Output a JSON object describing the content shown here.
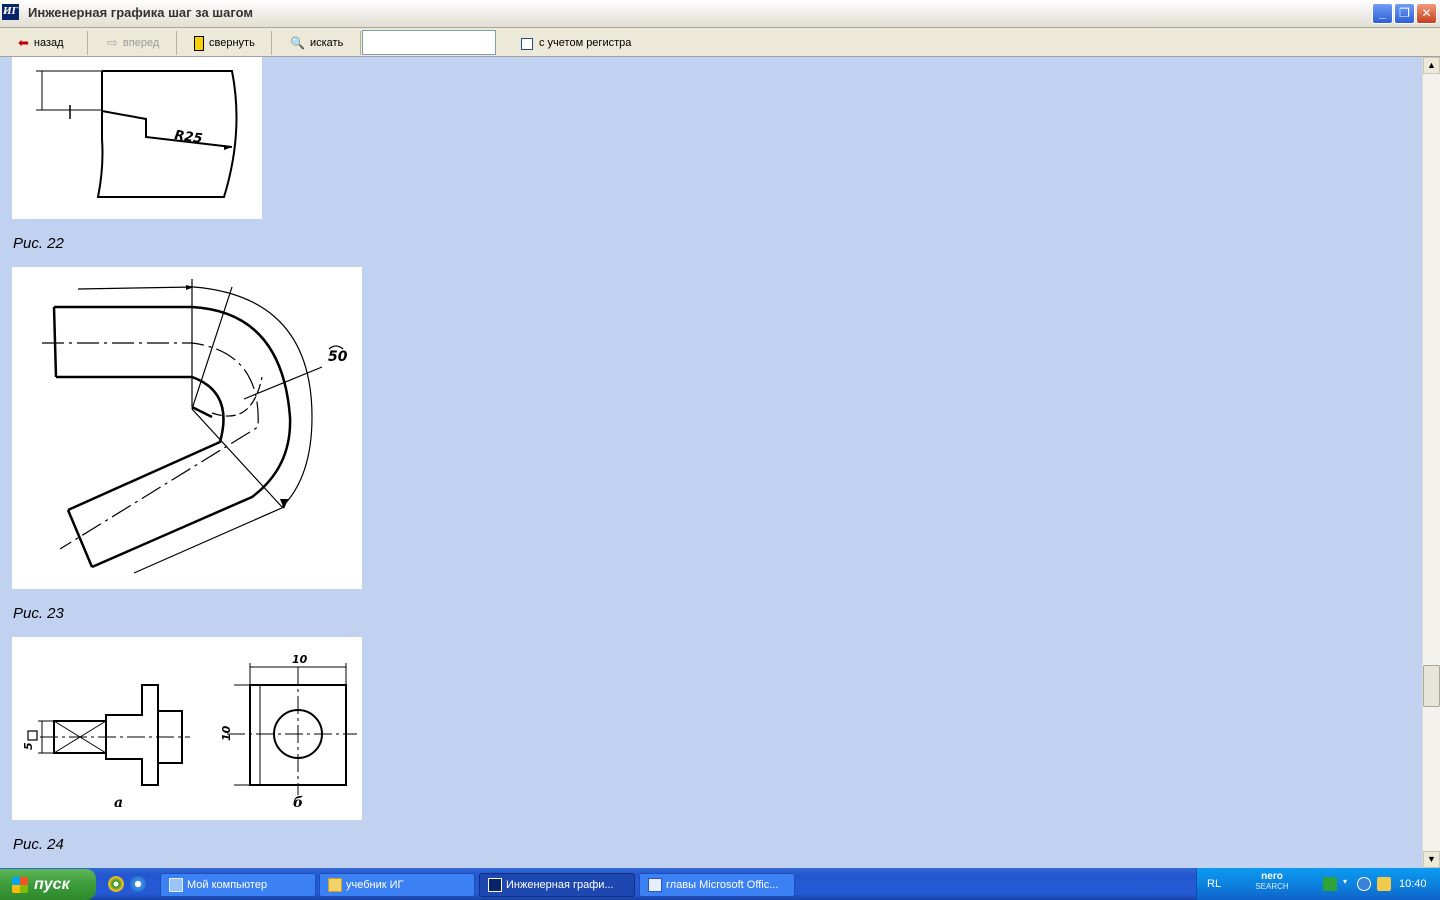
{
  "window": {
    "title": "Инженерная графика шаг за шагом",
    "icon_text": "ИГ",
    "minimize_glyph": "_",
    "maximize_glyph": "❐",
    "close_glyph": "✕"
  },
  "toolbar": {
    "back_label": "назад",
    "forward_label": "вперед",
    "collapse_label": "свернуть",
    "search_label": "искать",
    "search_value": "",
    "case_sensitive_label": "с учетом регистра",
    "case_sensitive_checked": false
  },
  "content": {
    "background": "#c1d2f1",
    "figures": [
      {
        "caption": "Рис. 22",
        "labels": [
          "R25"
        ]
      },
      {
        "caption": "Рис. 23",
        "labels": [
          "50"
        ]
      },
      {
        "caption": "Рис. 24",
        "labels": [
          "5",
          "10",
          "10",
          "а",
          "б"
        ]
      }
    ]
  },
  "scrollbar": {
    "up_glyph": "▲",
    "down_glyph": "▼"
  },
  "taskbar": {
    "start_label": "пуск",
    "items": [
      {
        "label": "Мой компьютер",
        "icon": "computer-icon",
        "active": false
      },
      {
        "label": "учебник ИГ",
        "icon": "folder-icon",
        "active": false
      },
      {
        "label": "Инженерная графи...",
        "icon": "app-icon",
        "active": true
      },
      {
        "label": "главы Microsoft Offic...",
        "icon": "word-icon",
        "active": false
      }
    ],
    "tray": {
      "language": "RL",
      "nero_top": "nero",
      "nero_bottom": "SEARCH",
      "time": "10:40"
    }
  }
}
